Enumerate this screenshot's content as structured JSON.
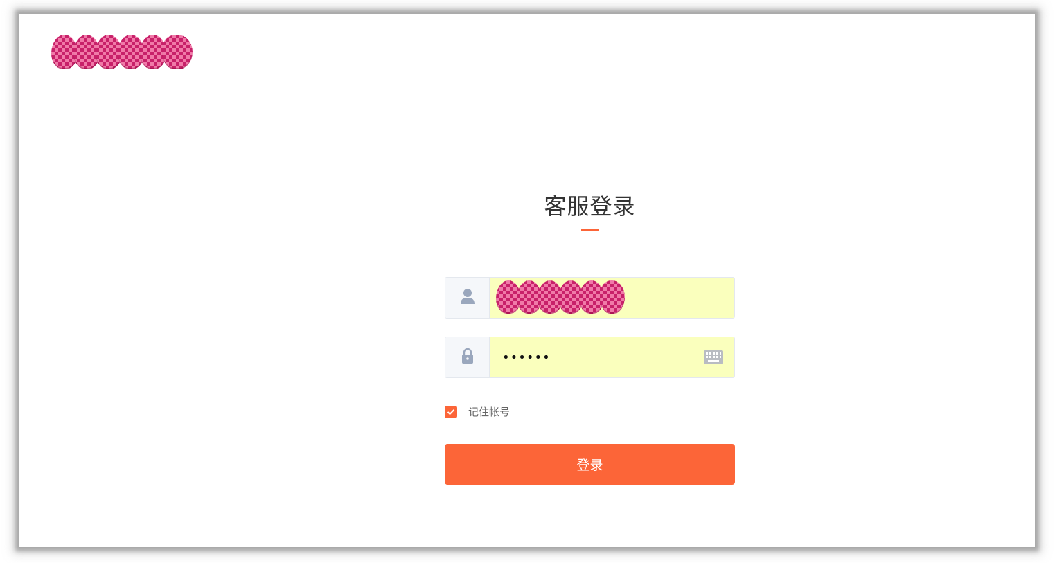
{
  "brand": {
    "logo_redacted": "redacted-logo"
  },
  "login": {
    "title": "客服登录",
    "username": {
      "value_redacted": "redacted-username",
      "icon": "user-icon"
    },
    "password": {
      "masked_value": "••••••",
      "icon": "lock-icon",
      "keyboard_icon": "keyboard-icon"
    },
    "remember": {
      "label": "记住帐号",
      "checked": true
    },
    "submit_label": "登录"
  },
  "colors": {
    "accent": "#fc6538",
    "autofill_bg": "#faffbd",
    "addon_bg": "#f5f7fa",
    "icon_gray": "#9aa7bd"
  }
}
